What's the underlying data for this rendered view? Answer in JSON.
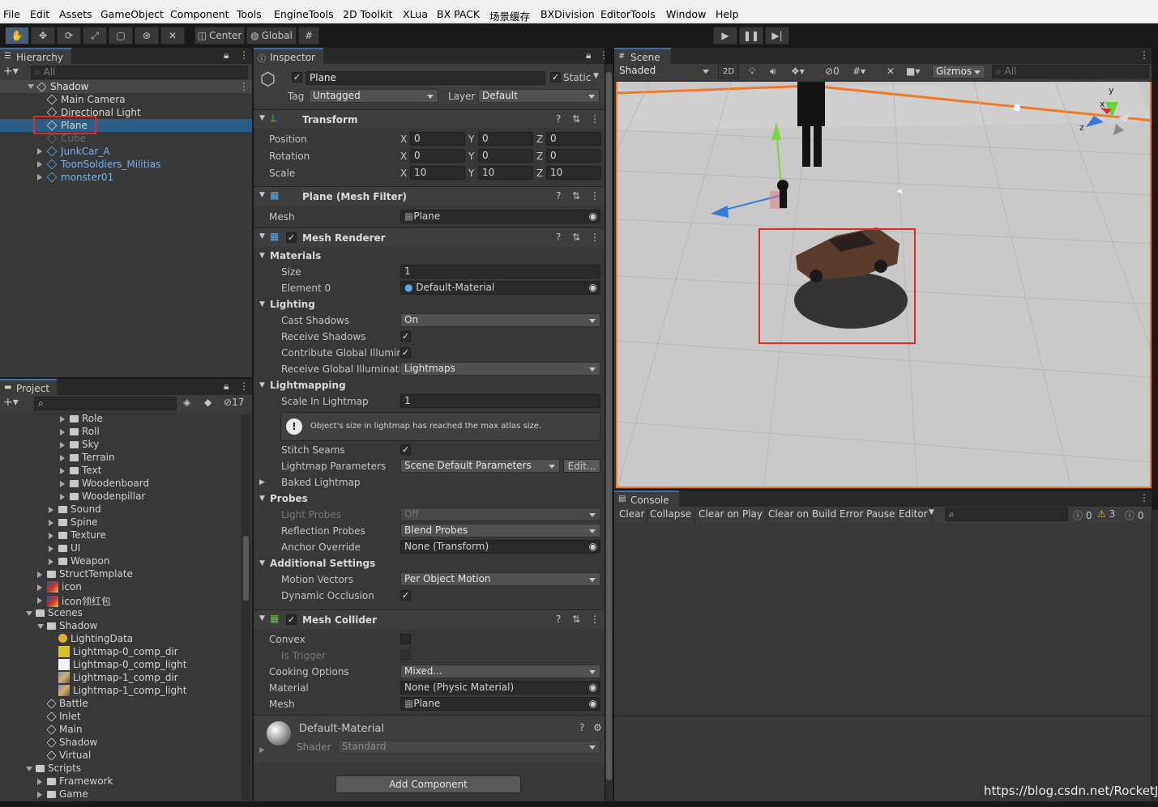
{
  "menu": [
    "File",
    "Edit",
    "Assets",
    "GameObject",
    "Component",
    "Tools",
    "EngineTools",
    "2D Toolkit",
    "XLua",
    "BX PACK",
    "场景缓存",
    "BXDivision",
    "EditorTools",
    "Window",
    "Help"
  ],
  "toolbar": {
    "center": "Center",
    "global": "Global"
  },
  "hierarchy": {
    "tab": "Hierarchy",
    "search": "All",
    "scene": "Shadow",
    "items": [
      {
        "label": "Main Camera",
        "type": "go"
      },
      {
        "label": "Directional Light",
        "type": "go"
      },
      {
        "label": "Plane",
        "type": "go",
        "selected": true
      },
      {
        "label": "Cube",
        "type": "go",
        "disabled": true
      },
      {
        "label": "JunkCar_A",
        "type": "prefab"
      },
      {
        "label": "ToonSoldiers_Militias",
        "type": "prefab"
      },
      {
        "label": "monster01",
        "type": "prefab"
      }
    ]
  },
  "project": {
    "tab": "Project",
    "hidden_count": "17",
    "items": [
      {
        "label": "Role",
        "indent": 3,
        "kind": "folder"
      },
      {
        "label": "Roll",
        "indent": 3,
        "kind": "folder"
      },
      {
        "label": "Sky",
        "indent": 3,
        "kind": "folder"
      },
      {
        "label": "Terrain",
        "indent": 3,
        "kind": "folder"
      },
      {
        "label": "Text",
        "indent": 3,
        "kind": "folder"
      },
      {
        "label": "Woodenboard",
        "indent": 3,
        "kind": "folder"
      },
      {
        "label": "Woodenpillar",
        "indent": 3,
        "kind": "folder"
      },
      {
        "label": "Sound",
        "indent": 2,
        "kind": "folder"
      },
      {
        "label": "Spine",
        "indent": 2,
        "kind": "folder"
      },
      {
        "label": "Texture",
        "indent": 2,
        "kind": "folder"
      },
      {
        "label": "UI",
        "indent": 2,
        "kind": "folder"
      },
      {
        "label": "Weapon",
        "indent": 2,
        "kind": "folder"
      },
      {
        "label": "StructTemplate",
        "indent": 1,
        "kind": "folder"
      },
      {
        "label": "icon",
        "indent": 1,
        "kind": "image"
      },
      {
        "label": "icon领红包",
        "indent": 1,
        "kind": "image"
      },
      {
        "label": "Scenes",
        "indent": 0,
        "kind": "folder-open"
      },
      {
        "label": "Shadow",
        "indent": 1,
        "kind": "folder-open"
      },
      {
        "label": "LightingData",
        "indent": 2,
        "kind": "asset"
      },
      {
        "label": "Lightmap-0_comp_dir",
        "indent": 2,
        "kind": "tex-yellow"
      },
      {
        "label": "Lightmap-0_comp_light",
        "indent": 2,
        "kind": "tex-white"
      },
      {
        "label": "Lightmap-1_comp_dir",
        "indent": 2,
        "kind": "tex-mixed"
      },
      {
        "label": "Lightmap-1_comp_light",
        "indent": 2,
        "kind": "tex-mixed"
      },
      {
        "label": "Battle",
        "indent": 1,
        "kind": "scene"
      },
      {
        "label": "Inlet",
        "indent": 1,
        "kind": "scene"
      },
      {
        "label": "Main",
        "indent": 1,
        "kind": "scene"
      },
      {
        "label": "Shadow",
        "indent": 1,
        "kind": "scene"
      },
      {
        "label": "Virtual",
        "indent": 1,
        "kind": "scene"
      },
      {
        "label": "Scripts",
        "indent": 0,
        "kind": "folder-open"
      },
      {
        "label": "Framework",
        "indent": 1,
        "kind": "folder"
      },
      {
        "label": "Game",
        "indent": 1,
        "kind": "folder"
      }
    ]
  },
  "inspector": {
    "tab": "Inspector",
    "name": "Plane",
    "static": "Static",
    "tag_label": "Tag",
    "tag": "Untagged",
    "layer_label": "Layer",
    "layer": "Default",
    "transform": {
      "title": "Transform",
      "position": "Position",
      "rotation": "Rotation",
      "scale": "Scale",
      "pos": [
        "0",
        "0",
        "0"
      ],
      "rot": [
        "0",
        "0",
        "0"
      ],
      "scl": [
        "10",
        "10",
        "10"
      ],
      "axes": [
        "X",
        "Y",
        "Z"
      ]
    },
    "meshfilter": {
      "title": "Plane (Mesh Filter)",
      "mesh_label": "Mesh",
      "mesh": "Plane"
    },
    "renderer": {
      "title": "Mesh Renderer",
      "materials": "Materials",
      "size_label": "Size",
      "size": "1",
      "element0_label": "Element 0",
      "element0": "Default-Material",
      "lighting": "Lighting",
      "cast_label": "Cast Shadows",
      "cast": "On",
      "receive_label": "Receive Shadows",
      "contrib_label": "Contribute Global Illumina",
      "recv_gi_label": "Receive Global Illuminatio",
      "recv_gi": "Lightmaps",
      "lightmapping": "Lightmapping",
      "scale_lm_label": "Scale In Lightmap",
      "scale_lm": "1",
      "warn": "Object's size in lightmap has reached the max atlas size.",
      "stitch_label": "Stitch Seams",
      "lmparams_label": "Lightmap Parameters",
      "lmparams": "Scene Default Parameters",
      "edit": "Edit...",
      "baked": "Baked Lightmap",
      "probes": "Probes",
      "lightprobes_label": "Light Probes",
      "lightprobes": "Off",
      "reflprobes_label": "Reflection Probes",
      "reflprobes": "Blend Probes",
      "anchor_label": "Anchor Override",
      "anchor": "None (Transform)",
      "additional": "Additional Settings",
      "motion_label": "Motion Vectors",
      "motion": "Per Object Motion",
      "dynocc_label": "Dynamic Occlusion"
    },
    "collider": {
      "title": "Mesh Collider",
      "convex": "Convex",
      "trigger": "Is Trigger",
      "cooking_label": "Cooking Options",
      "cooking": "Mixed...",
      "material_label": "Material",
      "material": "None (Physic Material)",
      "mesh_label": "Mesh",
      "mesh": "Plane"
    },
    "material": {
      "name": "Default-Material",
      "shader_label": "Shader",
      "shader": "Standard"
    },
    "add_component": "Add Component"
  },
  "scene": {
    "tab": "Scene",
    "shading": "Shaded",
    "mode2d": "2D",
    "hidden": "0",
    "gizmos": "Gizmos",
    "search": "All",
    "axis_y": "y",
    "axis_x": "x",
    "axis_z": "z"
  },
  "console": {
    "tab": "Console",
    "buttons": [
      "Clear",
      "Collapse",
      "Clear on Play",
      "Clear on Build",
      "Error Pause",
      "Editor"
    ],
    "info": "0",
    "warn": "3",
    "error": "0"
  },
  "watermark": "https://blog.csdn.net/RocketJ"
}
